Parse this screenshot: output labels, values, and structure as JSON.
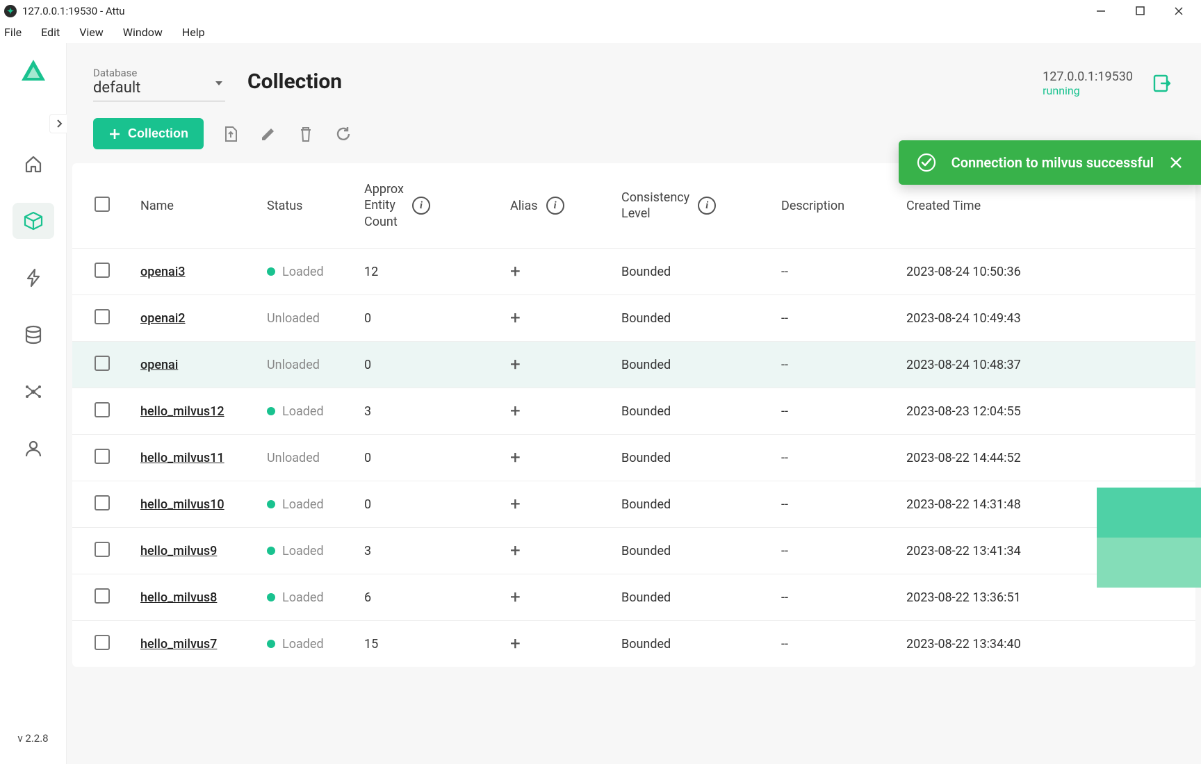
{
  "window": {
    "title": "127.0.0.1:19530 - Attu"
  },
  "menubar": [
    "File",
    "Edit",
    "View",
    "Window",
    "Help"
  ],
  "sidebar": {
    "version": "v 2.2.8"
  },
  "header": {
    "db_label": "Database",
    "db_value": "default",
    "page_title": "Collection",
    "conn_host": "127.0.0.1:19530",
    "conn_state": "running"
  },
  "toolbar": {
    "add_label": "Collection"
  },
  "toast": {
    "message": "Connection to milvus successful"
  },
  "table": {
    "headers": {
      "name": "Name",
      "status": "Status",
      "approx": "Approx\nEntity\nCount",
      "alias": "Alias",
      "consistency": "Consistency\nLevel",
      "description": "Description",
      "created": "Created Time"
    },
    "rows": [
      {
        "name": "openai3",
        "status": "Loaded",
        "loaded": true,
        "count": "12",
        "consistency": "Bounded",
        "description": "--",
        "created": "2023-08-24 10:50:36",
        "highlight": false
      },
      {
        "name": "openai2",
        "status": "Unloaded",
        "loaded": false,
        "count": "0",
        "consistency": "Bounded",
        "description": "--",
        "created": "2023-08-24 10:49:43",
        "highlight": false
      },
      {
        "name": "openai",
        "status": "Unloaded",
        "loaded": false,
        "count": "0",
        "consistency": "Bounded",
        "description": "--",
        "created": "2023-08-24 10:48:37",
        "highlight": true
      },
      {
        "name": "hello_milvus12",
        "status": "Loaded",
        "loaded": true,
        "count": "3",
        "consistency": "Bounded",
        "description": "--",
        "created": "2023-08-23 12:04:55",
        "highlight": false
      },
      {
        "name": "hello_milvus11",
        "status": "Unloaded",
        "loaded": false,
        "count": "0",
        "consistency": "Bounded",
        "description": "--",
        "created": "2023-08-22 14:44:52",
        "highlight": false
      },
      {
        "name": "hello_milvus10",
        "status": "Loaded",
        "loaded": true,
        "count": "0",
        "consistency": "Bounded",
        "description": "--",
        "created": "2023-08-22 14:31:48",
        "highlight": false
      },
      {
        "name": "hello_milvus9",
        "status": "Loaded",
        "loaded": true,
        "count": "3",
        "consistency": "Bounded",
        "description": "--",
        "created": "2023-08-22 13:41:34",
        "highlight": false
      },
      {
        "name": "hello_milvus8",
        "status": "Loaded",
        "loaded": true,
        "count": "6",
        "consistency": "Bounded",
        "description": "--",
        "created": "2023-08-22 13:36:51",
        "highlight": false
      },
      {
        "name": "hello_milvus7",
        "status": "Loaded",
        "loaded": true,
        "count": "15",
        "consistency": "Bounded",
        "description": "--",
        "created": "2023-08-22 13:34:40",
        "highlight": false
      }
    ]
  },
  "side_bars": [
    {
      "color": "#4fd1a6"
    },
    {
      "color": "#84ddb8"
    }
  ]
}
